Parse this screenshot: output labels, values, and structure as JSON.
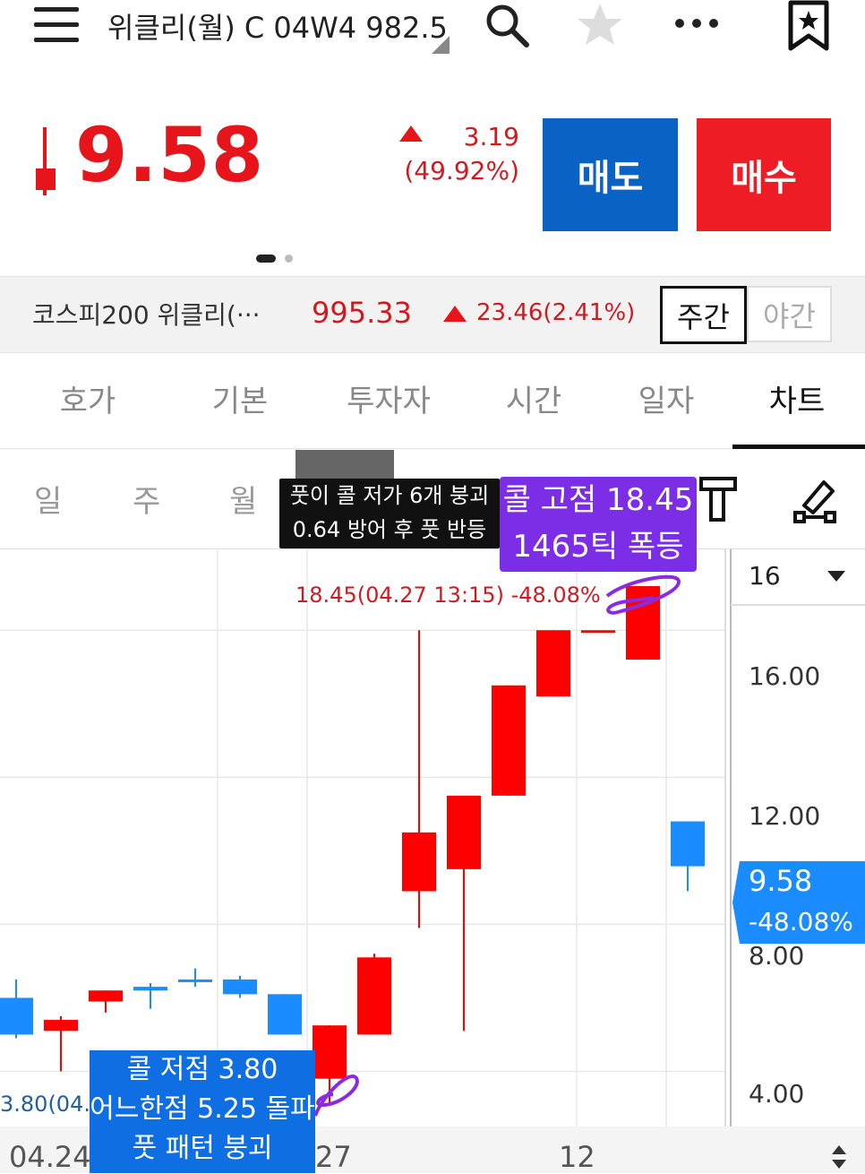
{
  "header": {
    "title": "위클리(월) C 04W4 982.5"
  },
  "price": {
    "current": "9.58",
    "change": "3.19",
    "change_pct": "(49.92%)",
    "sell_label": "매도",
    "buy_label": "매수"
  },
  "index": {
    "name": "코스피200 위클리(···",
    "value": "995.33",
    "change": "23.46(2.41%)",
    "day_label": "주간",
    "night_label": "야간"
  },
  "tabs": [
    "호가",
    "기본",
    "투자자",
    "시간",
    "일자",
    "차트"
  ],
  "periods": [
    "일",
    "주",
    "월"
  ],
  "chart_data": {
    "type": "candlestick",
    "ylim": [
      2.5,
      18.2
    ],
    "y_ticks": [
      "16.00",
      "12.00",
      "8.00",
      "4.00"
    ],
    "x_labels": [
      "04.24",
      "27",
      "12"
    ],
    "scale_select": "16",
    "current_price": "9.58",
    "current_pct": "-48.08%",
    "high_label": "18.45(04.27 13:15) -48.08%",
    "low_label": "3.80(04.2",
    "candles": [
      {
        "o": 5.0,
        "c": 6.0,
        "h": 6.5,
        "l": 4.9,
        "up": false
      },
      {
        "o": 5.1,
        "c": 5.4,
        "h": 5.5,
        "l": 4.0,
        "up": true
      },
      {
        "o": 5.9,
        "c": 6.2,
        "h": 6.2,
        "l": 5.6,
        "up": true
      },
      {
        "o": 6.3,
        "c": 6.2,
        "h": 6.4,
        "l": 5.7,
        "up": false
      },
      {
        "o": 6.5,
        "c": 6.5,
        "h": 6.8,
        "l": 6.3,
        "up": false
      },
      {
        "o": 6.5,
        "c": 6.1,
        "h": 6.6,
        "l": 6.0,
        "up": false
      },
      {
        "o": 6.1,
        "c": 5.0,
        "h": 6.1,
        "l": 5.0,
        "up": false
      },
      {
        "o": 3.8,
        "c": 5.25,
        "h": 5.25,
        "l": 3.1,
        "up": true
      },
      {
        "o": 5.0,
        "c": 7.1,
        "h": 7.2,
        "l": 5.0,
        "up": true
      },
      {
        "o": 8.9,
        "c": 10.5,
        "h": 16.0,
        "l": 7.9,
        "up": true
      },
      {
        "o": 9.5,
        "c": 11.5,
        "h": 11.5,
        "l": 5.1,
        "up": true
      },
      {
        "o": 11.5,
        "c": 14.5,
        "h": 14.5,
        "l": 11.5,
        "up": true
      },
      {
        "o": 14.2,
        "c": 16.0,
        "h": 16.0,
        "l": 14.2,
        "up": true
      },
      {
        "o": 16.0,
        "c": 16.0,
        "h": 16.0,
        "l": 16.0,
        "up": true
      },
      {
        "o": 15.2,
        "c": 17.2,
        "h": 17.2,
        "l": 15.2,
        "up": true
      },
      {
        "o": 9.58,
        "c": 10.8,
        "h": 10.8,
        "l": 8.9,
        "up": false
      }
    ]
  },
  "notes": {
    "black_line1": "풋이 콜 저가 6개 붕괴",
    "black_line2": "0.64 방어 후 풋 반등",
    "purple_line1": "콜 고점 18.45",
    "purple_line2": "1465틱 폭등",
    "blue_line1": "콜 저점 3.80",
    "blue_line2": "어느한점 5.25 돌파",
    "blue_line3": "풋 패턴 붕괴"
  },
  "colors": {
    "up": "#ff0000",
    "down": "#1a8cff",
    "sell": "#0a62c4",
    "buy": "#ee1c24",
    "note_purple": "#7c2ee6",
    "note_blue": "#0f6fe2"
  }
}
